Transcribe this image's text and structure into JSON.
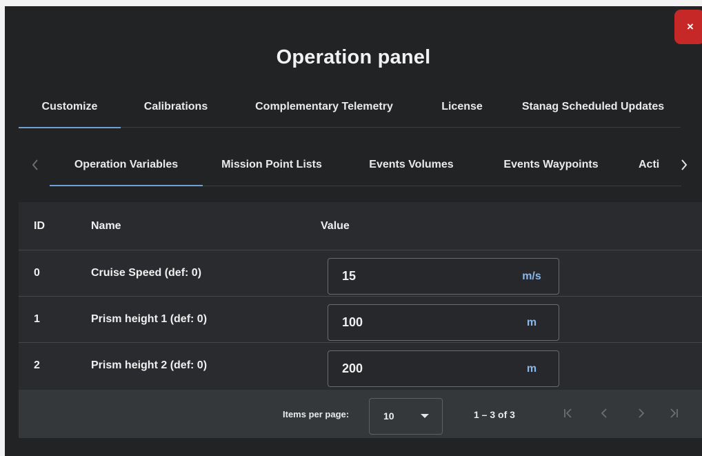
{
  "dialog": {
    "title": "Operation panel",
    "close_label": "×"
  },
  "main_tabs": [
    {
      "label": "Customize",
      "active": true
    },
    {
      "label": "Calibrations",
      "active": false
    },
    {
      "label": "Complementary Telemetry",
      "active": false
    },
    {
      "label": "License",
      "active": false
    },
    {
      "label": "Stanag Scheduled Updates",
      "active": false
    }
  ],
  "sub_tabs": [
    {
      "label": "Operation Variables",
      "active": true
    },
    {
      "label": "Mission Point Lists",
      "active": false
    },
    {
      "label": "Events Volumes",
      "active": false
    },
    {
      "label": "Events Waypoints",
      "active": false
    },
    {
      "label": "Acti",
      "active": false
    }
  ],
  "table": {
    "columns": [
      "ID",
      "Name",
      "Value"
    ],
    "rows": [
      {
        "id": "0",
        "name": "Cruise Speed (def: 0)",
        "value": "15",
        "unit": "m/s"
      },
      {
        "id": "1",
        "name": "Prism height 1 (def: 0)",
        "value": "100",
        "unit": "m"
      },
      {
        "id": "2",
        "name": "Prism height 2 (def: 0)",
        "value": "200",
        "unit": "m"
      }
    ]
  },
  "paginator": {
    "items_per_page_label": "Items per page:",
    "items_per_page": "10",
    "range_label": "1 – 3 of 3"
  },
  "colors": {
    "panel_bg": "#212325",
    "accent": "#6fa0d8",
    "unit": "#8ab8ec",
    "close": "#c62828"
  },
  "icons": [
    "close-icon",
    "chevron-left-icon",
    "chevron-right-icon",
    "dropdown-arrow-icon",
    "first-page-icon",
    "previous-page-icon",
    "next-page-icon",
    "last-page-icon"
  ]
}
